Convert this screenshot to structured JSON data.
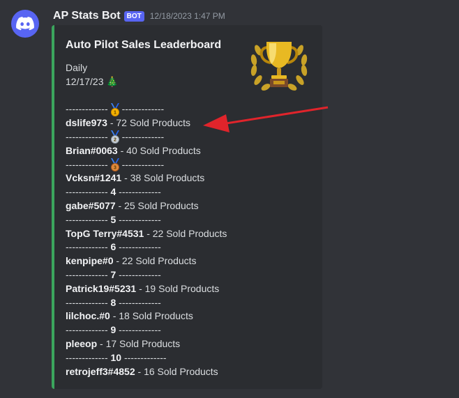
{
  "bot": {
    "name": "AP Stats Bot",
    "tag": "BOT",
    "timestamp": "12/18/2023 1:47 PM",
    "avatar_icon": "discord-logo-icon"
  },
  "embed": {
    "accent_color": "#3ba55d",
    "title": "Auto Pilot Sales Leaderboard",
    "thumbnail_icon": "trophy-icon",
    "period": "Daily",
    "date": "12/17/23",
    "date_emoji": "🎄",
    "leaderboard": [
      {
        "sep_left": "-------------",
        "rank_label": "",
        "medal": "gold-medal-icon",
        "sep_right": "-------------",
        "user": "dslife973",
        "rest": " - 72 Sold Products"
      },
      {
        "sep_left": "-------------",
        "rank_label": "",
        "medal": "silver-medal-icon",
        "sep_right": "-------------",
        "user": "Brian#0063",
        "rest": " - 40 Sold Products"
      },
      {
        "sep_left": "-------------",
        "rank_label": "",
        "medal": "bronze-medal-icon",
        "sep_right": "-------------",
        "user": "Vcksn#1241",
        "rest": " - 38 Sold Products"
      },
      {
        "sep_left": "------------- ",
        "rank_label": "4",
        "medal": "",
        "sep_right": " -------------",
        "user": "gabe#5077",
        "rest": " - 25 Sold Products"
      },
      {
        "sep_left": "------------- ",
        "rank_label": "5",
        "medal": "",
        "sep_right": " -------------",
        "user": "TopG Terry#4531",
        "rest": " - 22 Sold Products"
      },
      {
        "sep_left": "------------- ",
        "rank_label": "6",
        "medal": "",
        "sep_right": " -------------",
        "user": "kenpipe#0",
        "rest": " - 22 Sold Products"
      },
      {
        "sep_left": "------------- ",
        "rank_label": "7",
        "medal": "",
        "sep_right": " -------------",
        "user": "Patrick19#5231",
        "rest": " - 19 Sold Products"
      },
      {
        "sep_left": "------------- ",
        "rank_label": "8",
        "medal": "",
        "sep_right": " -------------",
        "user": "lilchoc.#0",
        "rest": " - 18 Sold Products"
      },
      {
        "sep_left": "------------- ",
        "rank_label": "9",
        "medal": "",
        "sep_right": " -------------",
        "user": "pleeop",
        "rest": " - 17 Sold Products"
      },
      {
        "sep_left": "------------- ",
        "rank_label": "10",
        "medal": "",
        "sep_right": " -------------",
        "user": "retrojeff3#4852",
        "rest": " - 16 Sold Products"
      }
    ]
  },
  "annotation": {
    "icon": "red-arrow-icon",
    "color": "#e0242b"
  }
}
